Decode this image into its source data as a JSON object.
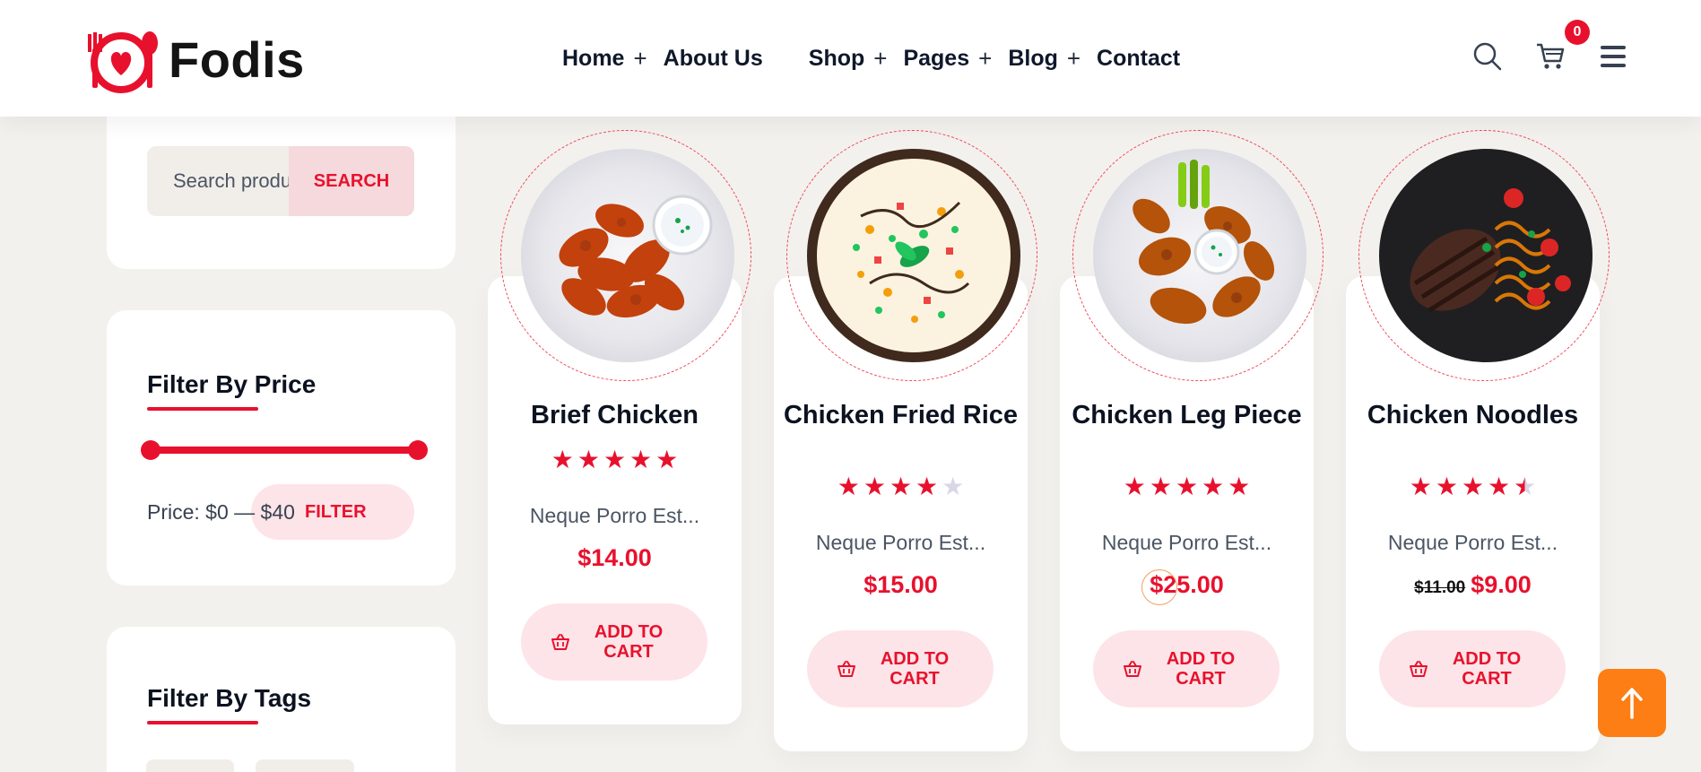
{
  "brand": {
    "name": "Fodis",
    "accent": "#e8112d"
  },
  "nav": {
    "items": [
      {
        "label": "Home",
        "has_submenu": true
      },
      {
        "label": "About Us",
        "has_submenu": false
      },
      {
        "label": "Shop",
        "has_submenu": true
      },
      {
        "label": "Pages",
        "has_submenu": true
      },
      {
        "label": "Blog",
        "has_submenu": true
      },
      {
        "label": "Contact",
        "has_submenu": false
      }
    ],
    "plus": "+"
  },
  "header": {
    "icons": [
      "search-icon",
      "cart-icon",
      "menu-icon"
    ],
    "cart_count": "0"
  },
  "sidebar": {
    "search": {
      "placeholder": "Search products",
      "button": "SEARCH"
    },
    "price_filter": {
      "title": "Filter By Price",
      "label": "Price: $0 — $40",
      "button": "FILTER",
      "range_min": 0,
      "range_max": 40
    },
    "tags": {
      "title": "Filter By Tags"
    }
  },
  "products": [
    {
      "name": "Brief Chicken",
      "rating": 5,
      "desc": "Neque Porro Est...",
      "price": "$14.00",
      "old_price": "",
      "button": "ADD TO CART",
      "plate": "wings"
    },
    {
      "name": "Chicken Fried Rice",
      "rating": 4,
      "desc": "Neque Porro Est...",
      "price": "$15.00",
      "old_price": "",
      "button": "ADD TO CART",
      "plate": "rice"
    },
    {
      "name": "Chicken Leg Piece",
      "rating": 5,
      "desc": "Neque Porro Est...",
      "price": "$25.00",
      "old_price": "",
      "button": "ADD TO CART",
      "plate": "legs"
    },
    {
      "name": "Chicken Noodles",
      "rating": 4.5,
      "desc": "Neque Porro Est...",
      "price": "$9.00",
      "old_price": "$11.00",
      "button": "ADD TO CART",
      "plate": "steak"
    }
  ],
  "back_to_top": {
    "icon": "arrow-up-icon",
    "color": "#fd7e14"
  }
}
